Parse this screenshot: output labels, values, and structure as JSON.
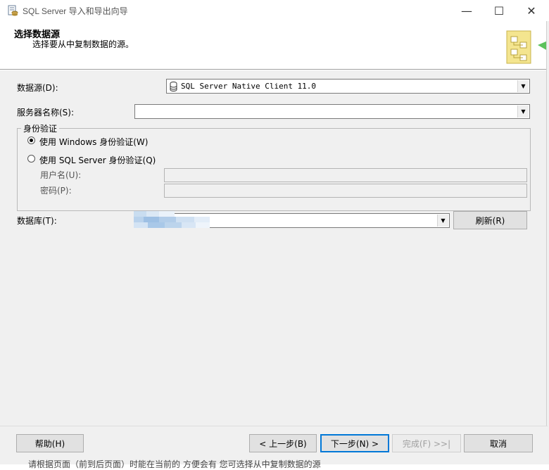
{
  "window": {
    "title": "SQL Server 导入和导出向导",
    "minimize_glyph": "—",
    "maximize_glyph": "☐",
    "close_glyph": "✕"
  },
  "header": {
    "title": "选择数据源",
    "subtitle": "选择要从中复制数据的源。"
  },
  "form": {
    "datasource_label": "数据源(D):",
    "datasource_value": "SQL Server Native Client 11.0",
    "server_label": "服务器名称(S):",
    "server_value": "",
    "auth_group_label": "身份验证",
    "windows_auth_label": "使用 Windows 身份验证(W)",
    "sql_auth_label": "使用 SQL Server 身份验证(Q)",
    "username_label": "用户名(U):",
    "password_label": "密码(P):",
    "database_label": "数据库(T):",
    "refresh_label": "刷新(R)"
  },
  "footer": {
    "help_label": "帮助(H)",
    "back_label": "< 上一步(B)",
    "next_label": "下一步(N) >",
    "finish_label": "完成(F) >>|",
    "cancel_label": "取消",
    "background_text": "请根据页面（前到后页面）时能在当前的    方便会有    您可选择从中复制数据的源"
  },
  "colors": {
    "accent": "#0078d7",
    "panel": "#f0f0f0"
  }
}
